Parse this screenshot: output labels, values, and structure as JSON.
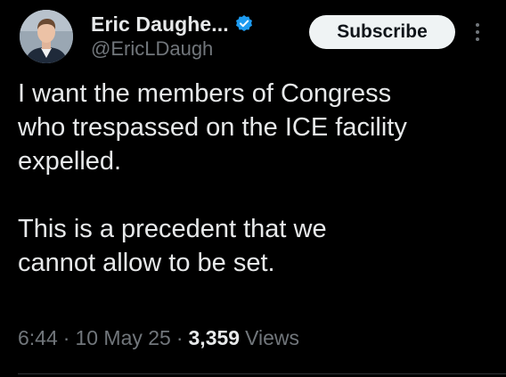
{
  "author": {
    "display_name": "Eric Daughe...",
    "handle": "@EricLDaugh",
    "verified": true,
    "avatar_icon": "profile-photo"
  },
  "actions": {
    "subscribe_label": "Subscribe",
    "more_icon": "vertical-ellipsis-icon"
  },
  "tweet": {
    "paragraphs": [
      "I want the members of Congress\nwho trespassed on the ICE facility\nexpelled.",
      "This is a precedent that we\ncannot allow to be set."
    ]
  },
  "meta": {
    "time": "6:44",
    "date": "10 May 25",
    "views_count": "3,359",
    "views_label": "Views",
    "separator": "·"
  },
  "colors": {
    "background": "#000000",
    "text_primary": "#e7e9ea",
    "text_secondary": "#71767b",
    "verified_blue": "#1d9bf0",
    "button_bg": "#eff3f4",
    "button_text": "#0f1419"
  }
}
